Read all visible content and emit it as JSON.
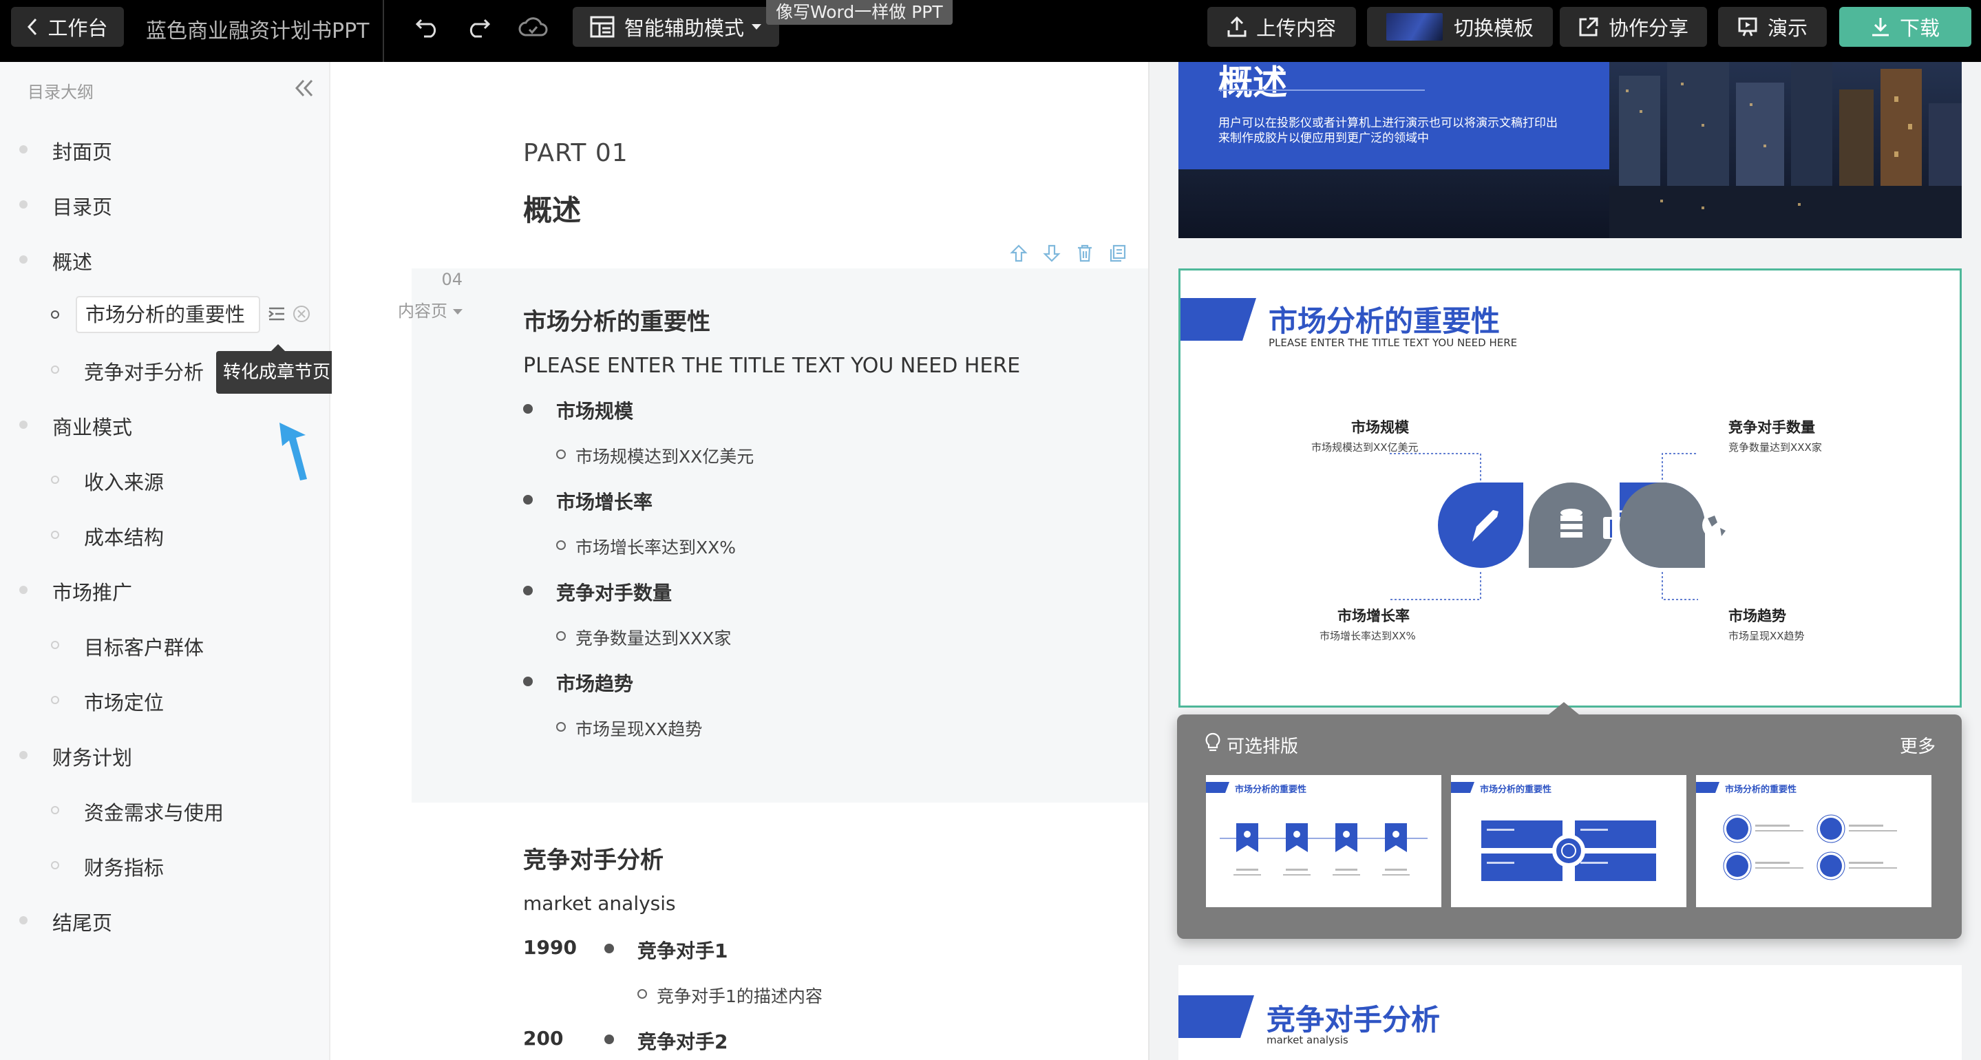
{
  "topbar": {
    "workbench_label": "工作台",
    "doc_title": "蓝色商业融资计划书PPT",
    "mode_label": "智能辅助模式",
    "tooltip": "像写Word一样做 PPT",
    "upload_label": "上传内容",
    "switch_template_label": "切换模板",
    "share_label": "协作分享",
    "present_label": "演示",
    "download_label": "下载",
    "accent_color": "#4fb89a"
  },
  "sidebar": {
    "header": "目录大纲",
    "items": [
      {
        "label": "封面页"
      },
      {
        "label": "目录页"
      },
      {
        "label": "概述"
      },
      {
        "label": "市场分析的重要性"
      },
      {
        "label": "竞争对手分析"
      },
      {
        "label": "商业模式"
      },
      {
        "label": "收入来源"
      },
      {
        "label": "成本结构"
      },
      {
        "label": "市场推广"
      },
      {
        "label": "目标客户群体"
      },
      {
        "label": "市场定位"
      },
      {
        "label": "财务计划"
      },
      {
        "label": "资金需求与使用"
      },
      {
        "label": "财务指标"
      },
      {
        "label": "结尾页"
      }
    ],
    "tooltip": "转化成章节页"
  },
  "editor": {
    "part": "PART 01",
    "part_title": "概述",
    "page_number": "04",
    "page_type": "内容页",
    "block1": {
      "title": "市场分析的重要性",
      "subtitle": "PLEASE ENTER THE TITLE TEXT YOU NEED HERE",
      "bullets": [
        {
          "label": "市场规模",
          "sub": "市场规模达到XX亿美元"
        },
        {
          "label": "市场增长率",
          "sub": "市场增长率达到XX%"
        },
        {
          "label": "竞争对手数量",
          "sub": "竞争数量达到XXX家"
        },
        {
          "label": "市场趋势",
          "sub": "市场呈现XX趋势"
        }
      ]
    },
    "block2": {
      "title": "竞争对手分析",
      "subtitle": "market analysis",
      "rows": [
        {
          "year": "1990",
          "label": "竞争对手1",
          "sub": "竞争对手1的描述内容"
        },
        {
          "year": "200",
          "label": "竞争对手2"
        }
      ]
    }
  },
  "preview": {
    "slide1": {
      "title": "概述",
      "text": "用户可以在投影仪或者计算机上进行演示也可以将演示文稿打印出来制作成胶片以便应用到更广泛的领域中"
    },
    "slide2": {
      "title": "市场分析的重要性",
      "subtitle": "PLEASE ENTER THE TITLE TEXT YOU NEED HERE",
      "items": [
        {
          "label": "市场规模",
          "desc": "市场规模达到XX亿美元"
        },
        {
          "label": "竞争对手数量",
          "desc": "竞争数量达到XXX家"
        },
        {
          "label": "市场增长率",
          "desc": "市场增长率达到XX%"
        },
        {
          "label": "市场趋势",
          "desc": "市场呈现XX趋势"
        }
      ]
    },
    "layouts": {
      "title": "可选排版",
      "more": "更多",
      "thumbs": [
        {
          "title": "市场分析的重要性"
        },
        {
          "title": "市场分析的重要性"
        },
        {
          "title": "市场分析的重要性"
        }
      ]
    },
    "slide3": {
      "title": "竞争对手分析",
      "subtitle": "market analysis"
    },
    "brand_color": "#2f55c4",
    "gray_color": "#707a86"
  }
}
